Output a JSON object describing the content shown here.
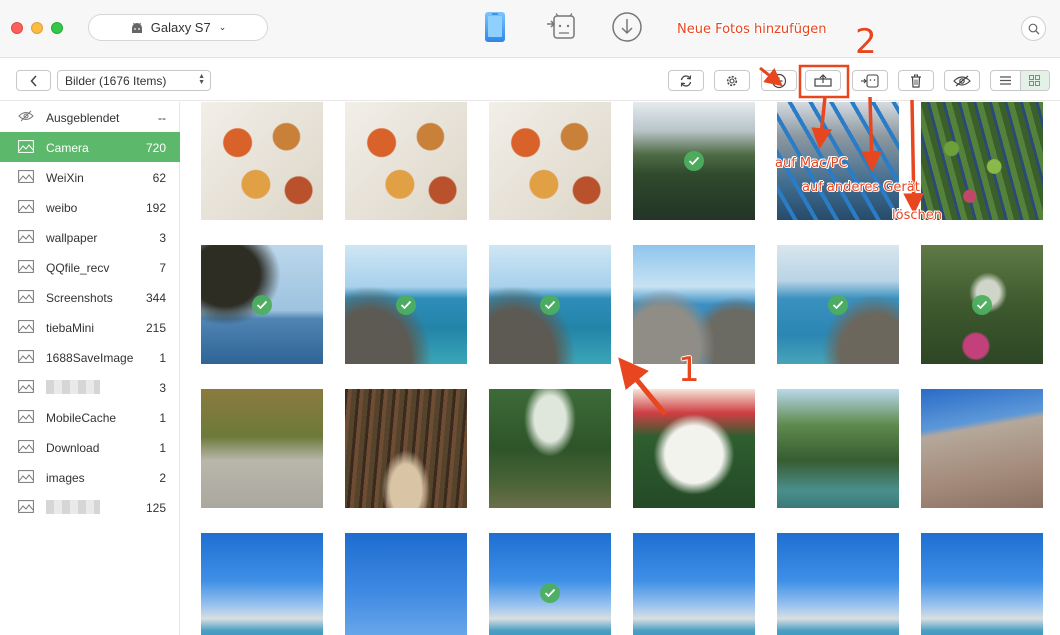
{
  "titlebar": {
    "device_name": "Galaxy S7",
    "device_icon": "android-icon",
    "modes": [
      {
        "name": "phone-manager-icon",
        "active": true
      },
      {
        "name": "android-mover-icon",
        "active": false
      },
      {
        "name": "download-icon",
        "active": false
      }
    ],
    "search_icon": "search-icon"
  },
  "toolbar": {
    "category": "Bilder (1676 Items)",
    "buttons": [
      "refresh-icon",
      "settings-icon",
      "add-icon",
      "export-to-computer-icon",
      "export-to-device-icon",
      "delete-icon",
      "hide-icon"
    ],
    "view_modes": [
      "list-view-icon",
      "grid-view-icon"
    ],
    "active_view": "grid"
  },
  "sidebar": {
    "items": [
      {
        "label": "Ausgeblendet",
        "count": "--",
        "icon": "hidden-eye-icon"
      },
      {
        "label": "Camera",
        "count": "720",
        "icon": "image-icon",
        "active": true
      },
      {
        "label": "WeiXin",
        "count": "62",
        "icon": "image-icon"
      },
      {
        "label": "weibo",
        "count": "192",
        "icon": "image-icon"
      },
      {
        "label": "wallpaper",
        "count": "3",
        "icon": "image-icon"
      },
      {
        "label": "QQfile_recv",
        "count": "7",
        "icon": "image-icon"
      },
      {
        "label": "Screenshots",
        "count": "344",
        "icon": "image-icon"
      },
      {
        "label": "tiebaMini",
        "count": "215",
        "icon": "image-icon"
      },
      {
        "label": "1688SaveImage",
        "count": "1",
        "icon": "image-icon"
      },
      {
        "label": "",
        "count": "3",
        "icon": "image-icon",
        "blurred": true
      },
      {
        "label": "MobileCache",
        "count": "1",
        "icon": "image-icon"
      },
      {
        "label": "Download",
        "count": "1",
        "icon": "image-icon"
      },
      {
        "label": "images",
        "count": "2",
        "icon": "image-icon"
      },
      {
        "label": "",
        "count": "125",
        "icon": "image-icon",
        "blurred": true
      }
    ]
  },
  "photos": [
    {
      "subject": "food-platter",
      "selected": false
    },
    {
      "subject": "food-platter",
      "selected": false
    },
    {
      "subject": "food-platter",
      "selected": false
    },
    {
      "subject": "pond-garden",
      "selected": true
    },
    {
      "subject": "harbor-boats",
      "selected": false
    },
    {
      "subject": "flower-wall",
      "selected": false
    },
    {
      "subject": "sea-tree",
      "selected": true
    },
    {
      "subject": "sea-cliff",
      "selected": true
    },
    {
      "subject": "sea-cliff",
      "selected": true
    },
    {
      "subject": "rocky-shore",
      "selected": false
    },
    {
      "subject": "sea-rocks",
      "selected": true
    },
    {
      "subject": "garden-waterfall",
      "selected": true
    },
    {
      "subject": "vine-arbor",
      "selected": false
    },
    {
      "subject": "forest-canopy",
      "selected": false
    },
    {
      "subject": "forest-path",
      "selected": false
    },
    {
      "subject": "white-flowers",
      "selected": false
    },
    {
      "subject": "tropical-pond",
      "selected": false
    },
    {
      "subject": "rock-inscription",
      "selected": false
    },
    {
      "subject": "beach-sky",
      "selected": false
    },
    {
      "subject": "blue-sky",
      "selected": false
    },
    {
      "subject": "beach-sky",
      "selected": true
    },
    {
      "subject": "beach-sky",
      "selected": false
    },
    {
      "subject": "beach-sky",
      "selected": false
    },
    {
      "subject": "beach-sky",
      "selected": false
    }
  ],
  "annotations": {
    "add_photos": "Neue Fotos hinzufügen",
    "step_two": "2",
    "to_mac": "auf Mac/PC",
    "to_device": "auf anderes Gerät",
    "delete": "löschen",
    "step_one": "1",
    "color": "#e7461f"
  }
}
